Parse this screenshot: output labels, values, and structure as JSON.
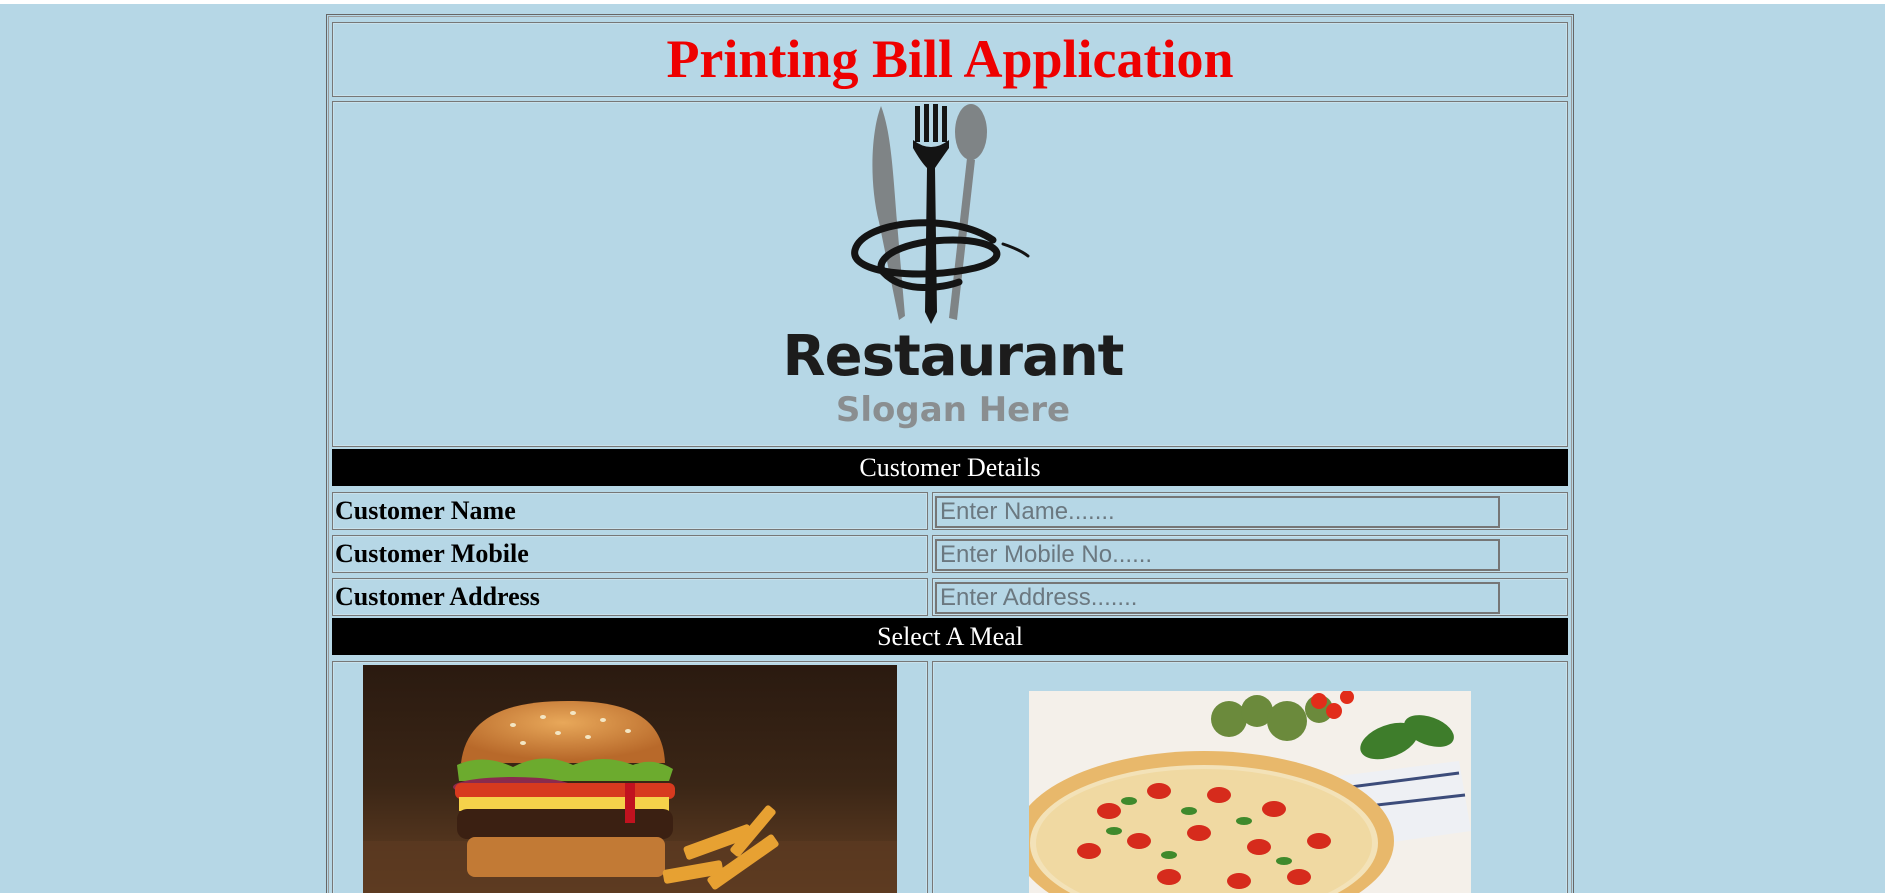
{
  "header": {
    "title": "Printing Bill Application"
  },
  "logo": {
    "name": "Restaurant",
    "slogan": "Slogan Here",
    "icon": "fork-knife-spoon-icon"
  },
  "customer_section": {
    "heading": "Customer Details",
    "fields": [
      {
        "label": "Customer Name",
        "placeholder": "Enter Name.......",
        "value": ""
      },
      {
        "label": "Customer Mobile",
        "placeholder": "Enter Mobile No......",
        "value": ""
      },
      {
        "label": "Customer Address",
        "placeholder": "Enter Address.......",
        "value": ""
      }
    ]
  },
  "meal_section": {
    "heading": "Select A Meal",
    "items": [
      {
        "image": "burger-photo"
      },
      {
        "image": "pizza-photo"
      }
    ]
  },
  "colors": {
    "background": "#b6d7e6",
    "title": "#ee0000",
    "section_bar": "#000000",
    "section_text": "#ffffff"
  }
}
